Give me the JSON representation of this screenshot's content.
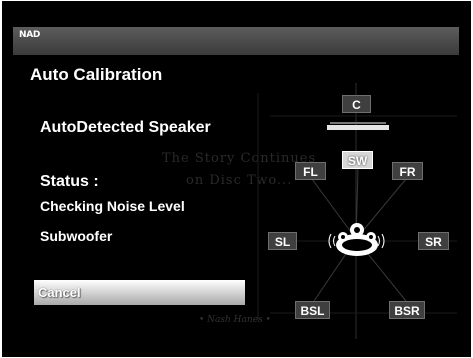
{
  "header": {
    "logo": "NAD"
  },
  "title": "Auto Calibration",
  "detected_label": "AutoDetected Speaker",
  "status": {
    "label": "Status :",
    "value": "Checking Noise Level",
    "sub": "Subwoofer"
  },
  "cancel_label": "Cancel",
  "watermark": {
    "line1": "The Story Continues",
    "line2": "on Disc Two...",
    "line3": "• Nash Hanes •"
  },
  "speakers": {
    "c": "C",
    "sw": "SW",
    "fl": "FL",
    "fr": "FR",
    "sl": "SL",
    "sr": "SR",
    "bsl": "BSL",
    "bsr": "BSR"
  },
  "active_speaker": "SW",
  "colors": {
    "background": "#000000",
    "header_bar": "#4a4a4a",
    "text": "#ffffff",
    "speaker_box": "#3f3f3f",
    "speaker_active": "#d6d6d6"
  }
}
